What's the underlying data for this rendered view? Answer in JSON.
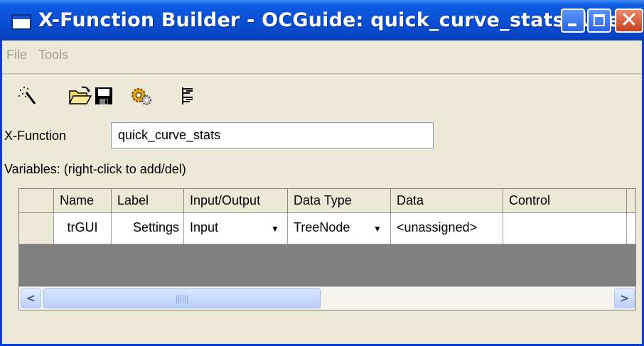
{
  "window": {
    "title": "X-Function Builder - OCGuide: quick_curve_stats (User)",
    "accent": "#0a4fd4"
  },
  "menu": {
    "items": [
      "File",
      "Tools"
    ]
  },
  "toolbar": {
    "icons": [
      "new-wand-icon",
      "open-folder-icon",
      "save-disk-icon",
      "compile-gear-icon",
      "tree-view-icon"
    ]
  },
  "form": {
    "xfunction_label": "X-Function",
    "xfunction_value": "quick_curve_stats",
    "variables_label": "Variables: (right-click to add/del)"
  },
  "grid": {
    "columns": [
      "Name",
      "Label",
      "Input/Output",
      "Data Type",
      "Data",
      "Control"
    ],
    "rows": [
      {
        "name": "trGUI",
        "label": "Settings",
        "io": "Input",
        "data_type": "TreeNode",
        "data": "<unassigned>",
        "control": ""
      }
    ]
  }
}
